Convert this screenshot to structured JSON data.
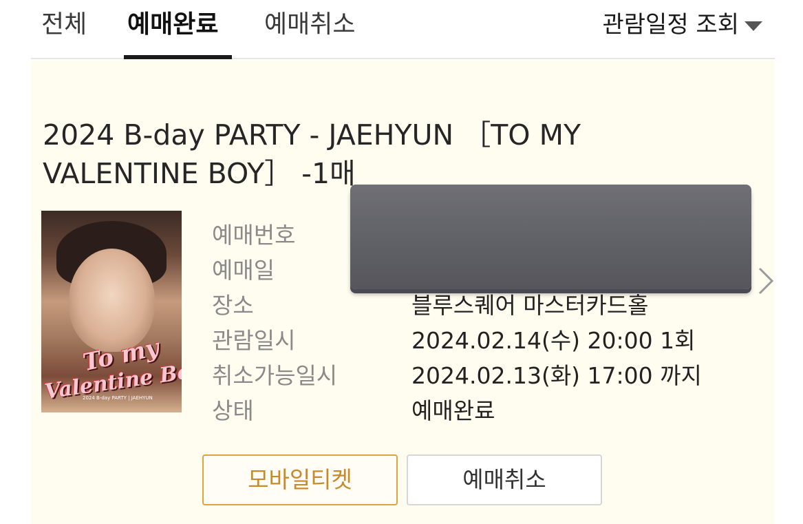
{
  "tabs": [
    {
      "label": "전체",
      "active": false
    },
    {
      "label": "예매완료",
      "active": true
    },
    {
      "label": "예매취소",
      "active": false
    }
  ],
  "schedule": {
    "label": "관람일정 조회",
    "icon": "caret-down-icon"
  },
  "booking": {
    "title": "2024 B-day PARTY - JAEHYUN ［TO MY VALENTINE BOY］ -1매",
    "poster": {
      "line1": "To my",
      "line2": "Valentine Boy",
      "fine_print": "2024 B-day PARTY | JAEHYUN"
    },
    "rows": [
      {
        "label": "예매번호",
        "value": ""
      },
      {
        "label": "예매일",
        "value": ""
      },
      {
        "label": "장소",
        "value": "블루스퀘어 마스터카드홀"
      },
      {
        "label": "관람일시",
        "value": "2024.02.14(수) 20:00 1회"
      },
      {
        "label": "취소가능일시",
        "value": "2024.02.13(화) 17:00 까지"
      },
      {
        "label": "상태",
        "value": "예매완료"
      }
    ],
    "buttons": {
      "mobile_ticket": "모바일티켓",
      "cancel": "예매취소"
    }
  },
  "colors": {
    "card_bg": "#fffdf0",
    "accent": "#e0a23a",
    "redaction": "#5f5f66"
  }
}
